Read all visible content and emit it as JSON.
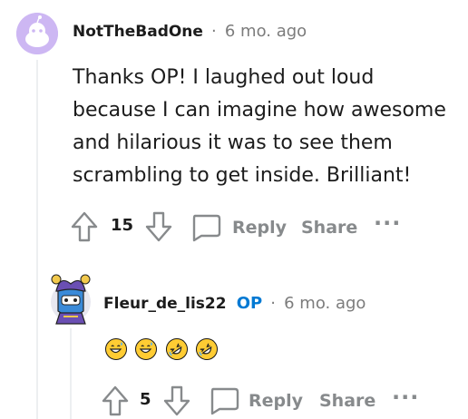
{
  "comments": [
    {
      "username": "NotTheBadOne",
      "separator": "·",
      "age": "6 mo. ago",
      "body": "Thanks OP! I laughed out loud because I can imagine how awesome and hilarious it was to see them scrambling to get inside. Brilliant!",
      "score": "15",
      "reply_label": "Reply",
      "share_label": "Share",
      "more_label": "···"
    },
    {
      "username": "Fleur_de_lis22",
      "op_badge": "OP",
      "separator": "·",
      "age": "6 mo. ago",
      "emojis": [
        "grinning-sweat-emoji",
        "grinning-sweat-emoji",
        "rolling-laughing-emoji",
        "rolling-laughing-emoji"
      ],
      "score": "5",
      "reply_label": "Reply",
      "share_label": "Share",
      "more_label": "···"
    }
  ],
  "colors": {
    "op": "#0079d3",
    "muted": "#878a8c",
    "avatar_bg": "#cdb7f3",
    "thread_line": "#edeff1"
  }
}
